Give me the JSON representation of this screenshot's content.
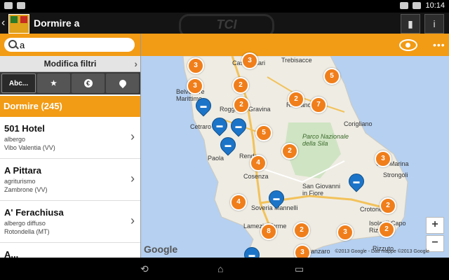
{
  "status": {
    "time": "10:14"
  },
  "header": {
    "title": "Dormire a",
    "brand_text": "TCI"
  },
  "search": {
    "value": "a"
  },
  "filters": {
    "label": "Modifica filtri"
  },
  "tabs": [
    {
      "label": "Abc..."
    },
    {
      "icon": "star-icon"
    },
    {
      "label": "€"
    },
    {
      "icon": "pin-icon"
    }
  ],
  "section": {
    "label": "Dormire (245)"
  },
  "results": [
    {
      "name": "501 Hotel",
      "type": "albergo",
      "location": "Vibo Valentia (VV)"
    },
    {
      "name": "A Pittara",
      "type": "agriturismo",
      "location": "Zambrone (VV)"
    },
    {
      "name": "A' Ferachiusa",
      "type": "albergo diffuso",
      "location": "Rotondella (MT)"
    },
    {
      "name": "A...",
      "type": "",
      "location": ""
    }
  ],
  "map": {
    "places": [
      "Castrovillari",
      "Trebisacce",
      "Belvedere Marittimo",
      "Roggiano Gravina",
      "Rossano",
      "Corigliano",
      "Cetraro",
      "Parco Nazionale della Sila",
      "Cirò Marina",
      "Rende",
      "Cosenza",
      "Paola",
      "San Giovanni in Fiore",
      "Strongoli",
      "Crotone",
      "Soveria Mannelli",
      "Lamezia Terme",
      "Isola di Capo Rizzuto",
      "Catanzaro",
      "Rizzuto"
    ],
    "clusters": [
      "3",
      "2",
      "3",
      "2",
      "2",
      "7",
      "5",
      "2",
      "3",
      "4",
      "2",
      "4",
      "8",
      "2",
      "3",
      "2",
      "3",
      "3",
      "5"
    ],
    "markers": [
      "hotel",
      "hotel",
      "hotel",
      "hotel",
      "hotel",
      "hotel",
      "hotel"
    ],
    "google_label": "Google",
    "copyright": "©2013 Google - Dati mappe ©2013 Google",
    "zoom_in": "+",
    "zoom_out": "−"
  }
}
